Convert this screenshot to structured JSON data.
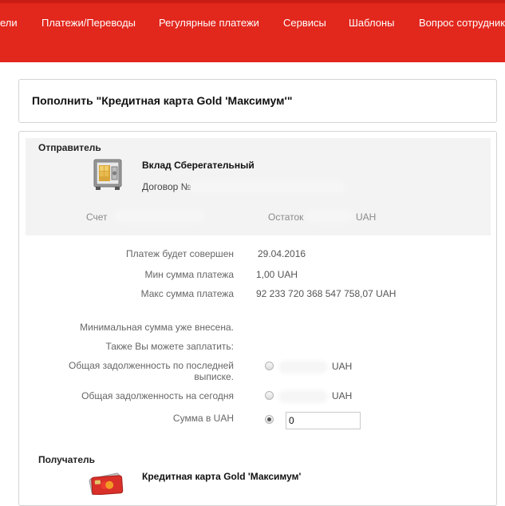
{
  "nav": {
    "items": [
      {
        "label": "ели"
      },
      {
        "label": "Платежи/Переводы"
      },
      {
        "label": "Регулярные платежи"
      },
      {
        "label": "Сервисы"
      },
      {
        "label": "Шаблоны"
      },
      {
        "label": "Вопрос сотруднику"
      }
    ]
  },
  "page": {
    "title": "Пополнить \"Кредитная карта Gold 'Максимум'\""
  },
  "sender": {
    "label": "Отправитель",
    "account_name": "Вклад Сберегательный",
    "contract_label": "Договор №",
    "account_label": "Счет",
    "balance_label": "Остаток",
    "balance_currency": "UAH"
  },
  "payment": {
    "date_label": "Платеж будет совершен",
    "date_value": "29.04.2016",
    "min_label": "Мин сумма платежа",
    "min_value": "1,00 UAH",
    "max_label": "Макс сумма платежа",
    "max_value": "92 233 720 368 547 758,07 UAH",
    "min_paid_note": "Минимальная сумма уже внесена.",
    "also_pay_note": "Также Вы можете заплатить:",
    "options": [
      {
        "label": "Общая задолженность по последней выписке.",
        "currency": "UAH",
        "checked": false
      },
      {
        "label": "Общая задолженность на сегодня",
        "currency": "UAH",
        "checked": false
      },
      {
        "label": "Сумма в UAH",
        "checked": true
      }
    ],
    "amount_value": "0"
  },
  "recipient": {
    "label": "Получатель",
    "account_name": "Кредитная карта Gold 'Максимум'"
  },
  "colors": {
    "brand_red": "#e2271d",
    "panel_gray": "#f3f3f3",
    "border": "#d4d4d4"
  }
}
